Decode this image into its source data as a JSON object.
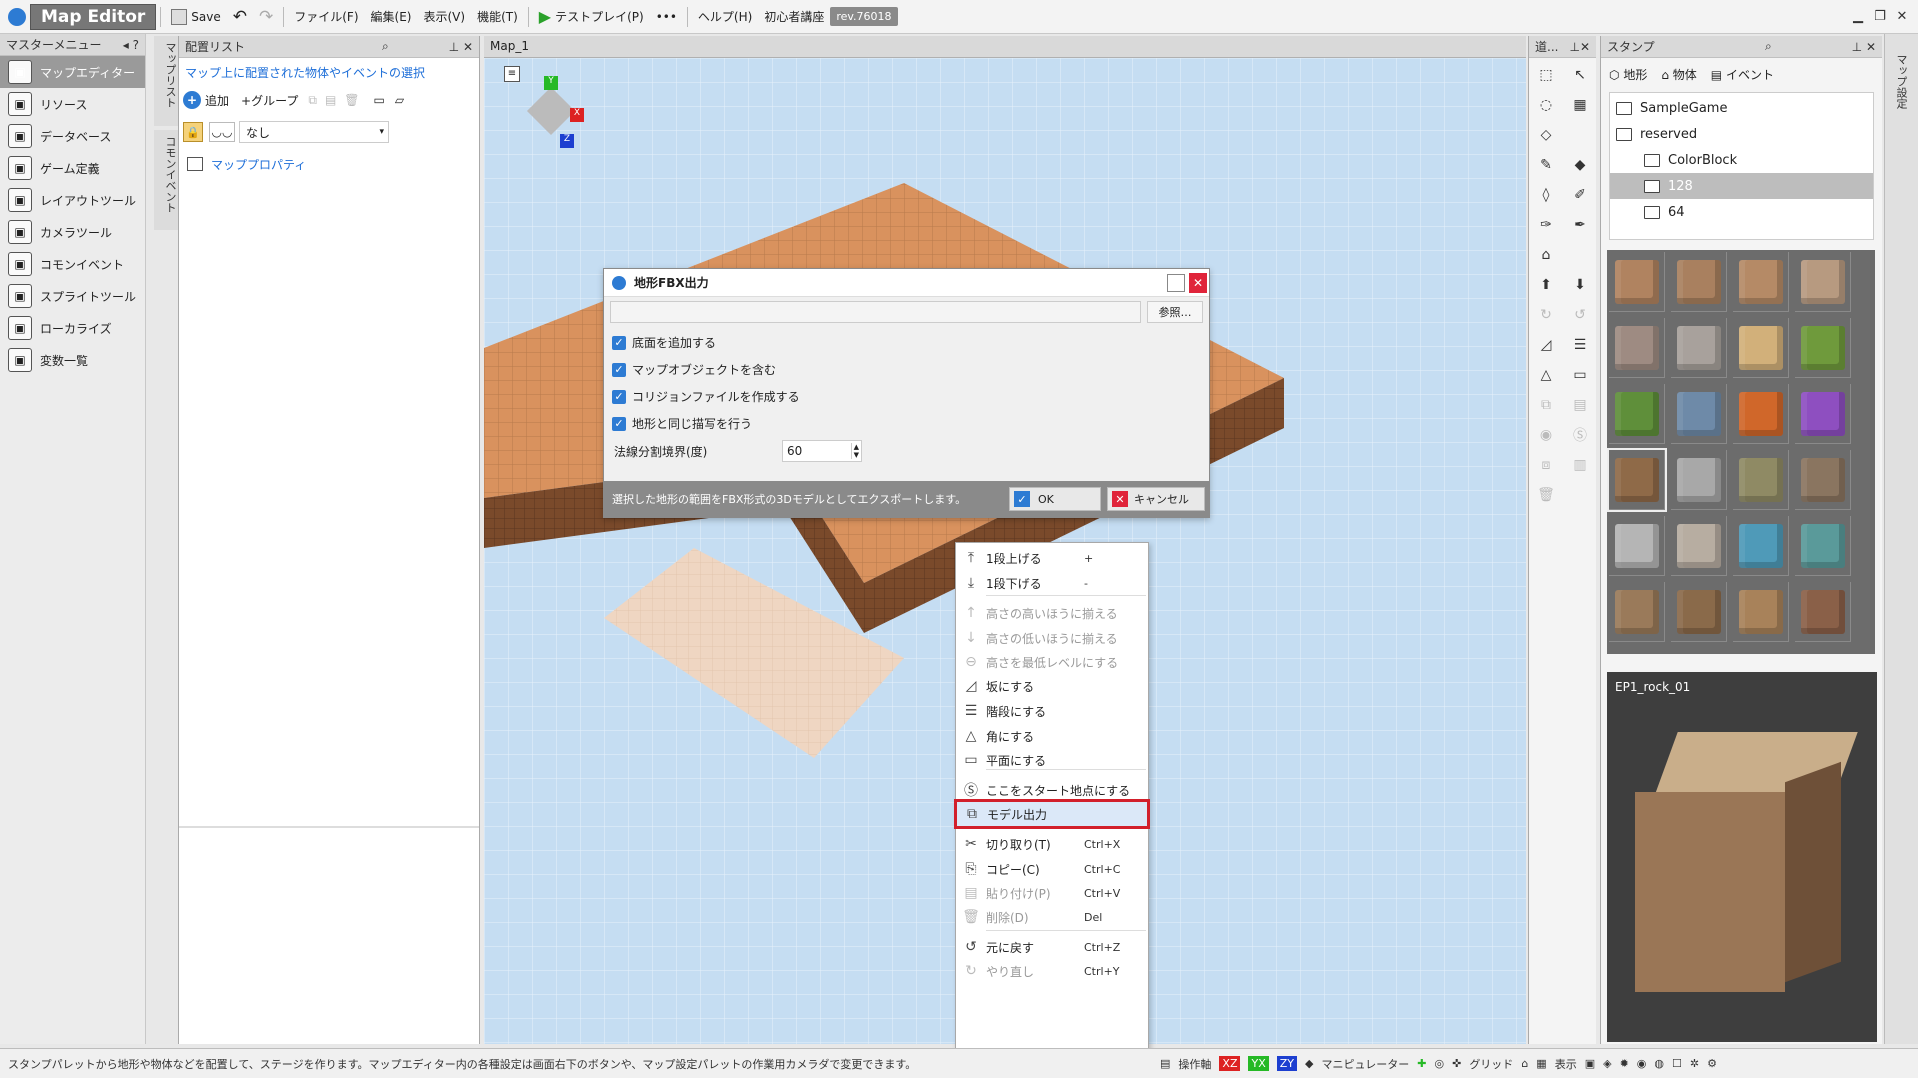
{
  "titlebar": {
    "app_name": "Map Editor",
    "save_label": "Save",
    "menus": [
      "ファイル(F)",
      "編集(E)",
      "表示(V)",
      "機能(T)"
    ],
    "testplay_label": "テストプレイ(P)",
    "more_label": "•••",
    "help_label": "ヘルプ(H)",
    "tutorial_label": "初心者講座",
    "revision": "rev.76018"
  },
  "master_menu": {
    "title": "マスターメニュー",
    "items": [
      {
        "label": "マップエディター",
        "icon": "map-editor-icon",
        "active": true
      },
      {
        "label": "リソース",
        "icon": "resource-icon",
        "active": false
      },
      {
        "label": "データベース",
        "icon": "database-icon",
        "active": false
      },
      {
        "label": "ゲーム定義",
        "icon": "game-definition-icon",
        "active": false
      },
      {
        "label": "レイアウトツール",
        "icon": "layout-tool-icon",
        "active": false
      },
      {
        "label": "カメラツール",
        "icon": "camera-tool-icon",
        "active": false
      },
      {
        "label": "コモンイベント",
        "icon": "common-event-icon",
        "active": false
      },
      {
        "label": "スプライトツール",
        "icon": "sprite-tool-icon",
        "active": false
      },
      {
        "label": "ローカライズ",
        "icon": "localize-icon",
        "active": false
      },
      {
        "label": "変数一覧",
        "icon": "variable-list-icon",
        "active": false
      }
    ]
  },
  "side_tabs": {
    "map_list": "マップリスト",
    "common_event": "コモンイベント"
  },
  "placement_list": {
    "title": "配置リスト",
    "hint": "マップ上に配置された物体やイベントの選択",
    "add_label": "追加",
    "group_label": "+グループ",
    "layer_value": "なし",
    "map_property": "マッププロパティ"
  },
  "viewport": {
    "tab": "Map_1",
    "axes": {
      "x": "X",
      "y": "Y",
      "z": "Z"
    }
  },
  "dialog": {
    "title": "地形FBX出力",
    "path_value": "",
    "browse_label": "参照…",
    "options": [
      {
        "label": "底面を追加する",
        "checked": true
      },
      {
        "label": "マップオブジェクトを含む",
        "checked": true
      },
      {
        "label": "コリジョンファイルを作成する",
        "checked": true
      },
      {
        "label": "地形と同じ描写を行う",
        "checked": true
      }
    ],
    "normal_label": "法線分割境界(度)",
    "normal_value": "60",
    "description": "選択した地形の範囲をFBX形式の3Dモデルとしてエクスポートします。",
    "ok_label": "OK",
    "cancel_label": "キャンセル"
  },
  "context_menu": {
    "items": [
      {
        "label": "1段上げる",
        "shortcut": "+",
        "icon": "raise-icon",
        "disabled": false
      },
      {
        "label": "1段下げる",
        "shortcut": "-",
        "icon": "lower-icon",
        "disabled": false
      },
      {
        "label": "高さの高いほうに揃える",
        "shortcut": "",
        "icon": "align-high-icon",
        "disabled": true
      },
      {
        "label": "高さの低いほうに揃える",
        "shortcut": "",
        "icon": "align-low-icon",
        "disabled": true
      },
      {
        "label": "高さを最低レベルにする",
        "shortcut": "",
        "icon": "min-level-icon",
        "disabled": true
      },
      {
        "label": "坂にする",
        "shortcut": "",
        "icon": "slope-icon",
        "disabled": false
      },
      {
        "label": "階段にする",
        "shortcut": "",
        "icon": "stairs-icon",
        "disabled": false
      },
      {
        "label": "角にする",
        "shortcut": "",
        "icon": "corner-icon",
        "disabled": false
      },
      {
        "label": "平面にする",
        "shortcut": "",
        "icon": "flat-icon",
        "disabled": false
      },
      {
        "label": "ここをスタート地点にする",
        "shortcut": "",
        "icon": "start-point-icon",
        "disabled": false
      },
      {
        "label": "モデル出力",
        "shortcut": "",
        "icon": "model-export-icon",
        "disabled": false,
        "highlighted": true
      },
      {
        "label": "切り取り(T)",
        "shortcut": "Ctrl+X",
        "icon": "cut-icon",
        "disabled": false
      },
      {
        "label": "コピー(C)",
        "shortcut": "Ctrl+C",
        "icon": "copy-icon",
        "disabled": false
      },
      {
        "label": "貼り付け(P)",
        "shortcut": "Ctrl+V",
        "icon": "paste-icon",
        "disabled": true
      },
      {
        "label": "削除(D)",
        "shortcut": "Del",
        "icon": "delete-icon",
        "disabled": true
      },
      {
        "label": "元に戻す",
        "shortcut": "Ctrl+Z",
        "icon": "undo-icon",
        "disabled": false
      },
      {
        "label": "やり直し",
        "shortcut": "Ctrl+Y",
        "icon": "redo-icon",
        "disabled": true
      }
    ]
  },
  "tools_panel": {
    "title": "道..."
  },
  "stamp": {
    "title": "スタンプ",
    "tabs": [
      "地形",
      "物体",
      "イベント"
    ],
    "tree": [
      {
        "label": "SampleGame",
        "depth": 0,
        "selected": false
      },
      {
        "label": "reserved",
        "depth": 0,
        "selected": false
      },
      {
        "label": "ColorBlock",
        "depth": 1,
        "selected": false
      },
      {
        "label": "128",
        "depth": 1,
        "selected": true
      },
      {
        "label": "64",
        "depth": 1,
        "selected": false
      }
    ],
    "tiles": [
      "#b08360",
      "#a9805f",
      "#b58a66",
      "#b79a80",
      "#9e8b82",
      "#a8a19c",
      "#d2b07a",
      "#6f9a3c",
      "#5f8f3a",
      "#6e8aa8",
      "#d0672a",
      "#8e4fc0",
      "#8f6a48",
      "#a8a8a8",
      "#8f8a64",
      "#8a7560",
      "#b5b5b5",
      "#b7ada1",
      "#4f9ab8",
      "#5a9a9a",
      "#9a7a5a",
      "#8a6a4a",
      "#a8825a",
      "#8a6048"
    ],
    "preview_name": "EP1_rock_01",
    "edge_label": "マップ設定"
  },
  "status": {
    "message": "スタンプパレットから地形や物体などを配置して、ステージを作ります。マップエディター内の各種設定は画面右下のボタンや、マップ設定パレットの作業用カメラダで変更できます。",
    "labels": [
      "操作軸",
      "XZ",
      "YX",
      "ZY",
      "マニピュレーター",
      "グリッド",
      "表示"
    ]
  },
  "colors": {
    "accent_blue": "#1d6ed8",
    "highlight_red": "#d21f2b",
    "terrain_top": "#d9925e",
    "terrain_side": "#7a4a2b",
    "sky": "#c5ddf2"
  }
}
